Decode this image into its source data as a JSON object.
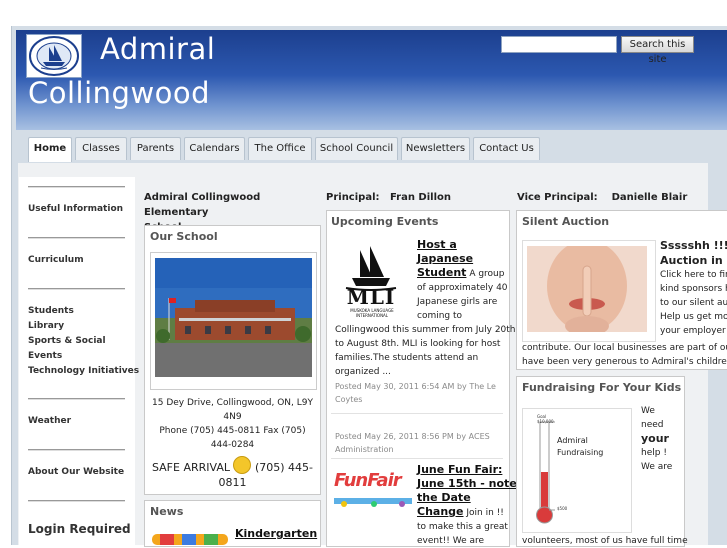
{
  "header": {
    "title_line1": "Admiral",
    "title_line2": "Collingwood",
    "logo_icon": "school-crest-icon"
  },
  "search": {
    "placeholder": "",
    "button_label": "Search this site"
  },
  "nav": {
    "tabs": [
      {
        "label": "Home",
        "active": true
      },
      {
        "label": "Classes"
      },
      {
        "label": "Parents"
      },
      {
        "label": "Calendars"
      },
      {
        "label": "The Office"
      },
      {
        "label": "School Council"
      },
      {
        "label": "Newsletters"
      },
      {
        "label": "Contact Us"
      }
    ]
  },
  "sidebar": {
    "useful_information": "Useful Information",
    "curriculum": "Curriculum",
    "students": "Students",
    "library": "Library",
    "sports_social_events": "Sports & Social",
    "events": "Events",
    "technology": "Technology Initiatives",
    "weather": "Weather",
    "about": "About Our Website",
    "login": "Login Required"
  },
  "left_col": {
    "heading_line1": "Admiral Collingwood Elementary",
    "heading_line2": "School",
    "our_school": {
      "title": "Our School",
      "address_line1": "15 Dey Drive, Collingwood, ON, L9Y",
      "address_line2": "4N9",
      "phone_line1": "Phone (705) 445-0811     Fax (705)",
      "phone_line2": "444-0284",
      "safe_arrival_a": "SAFE ARRIVAL",
      "safe_arrival_b": "(705) 445-",
      "safe_arrival_c": "0811"
    },
    "news": {
      "title": "News",
      "item1": "Kindergarten"
    }
  },
  "mid_col": {
    "principal_label": "Principal:",
    "principal_name": "Fran Dillon",
    "upcoming": {
      "title": "Upcoming Events",
      "event1": {
        "title_l1": "Host a",
        "title_l2": "Japanese",
        "title_l3": "Student",
        "desc_l1": "A group",
        "desc_l2": "of approximately 40",
        "desc_l3": "Japanese girls are",
        "desc_l4": "coming to",
        "desc_l5": "Collingwood this summer from July 20th",
        "desc_l6": "to August 8th. MLI is looking for host",
        "desc_l7": "families.The students attend an",
        "desc_l8": "organized ...",
        "meta_l1": "Posted May 30, 2011 6:54 AM by The Le",
        "meta_l2": "Coytes",
        "logo_text": "MLI",
        "logo_sub": "MUSKOKA LANGUAGE INTERNATIONAL"
      },
      "event2": {
        "meta_l1": "Posted May 26, 2011 8:56 PM by ACES",
        "meta_l2": "Administration"
      },
      "event3": {
        "title_l1": "June Fun Fair:",
        "title_l2": "June 15th - note",
        "title_l3": "the Date",
        "title_l4": "Change",
        "desc_l1": "Join in !!",
        "desc_l2": "to make this a great",
        "desc_l3": "event!! We are",
        "logo_text": "FunFair"
      }
    }
  },
  "right_col": {
    "vp_label": "Vice Principal:",
    "vp_name": "Danielle Blair",
    "auction": {
      "title": "Silent Auction",
      "headline_l1": "Ssssshh !!!;",
      "headline_l2": "Auction in p",
      "text_l1": "Click here to fin",
      "text_l2": "kind sponsors h",
      "text_l3": "to our silent auc",
      "text_l4": "Help us get mor",
      "text_l5": "your employer i",
      "text_l6": "contribute. Our local businesses are part of our c",
      "text_l7": "have been very generous to Admiral's children."
    },
    "fundraising": {
      "title": "Fundraising For Your Kids",
      "chart_label_l1": "Admiral",
      "chart_label_l2": "Fundraising",
      "goal_label": "Goal",
      "goal_value": "$10,000",
      "current_value": "$500",
      "text_l1": "We",
      "text_l2": "need",
      "text_l3": "your",
      "text_l4": "help !",
      "text_l5": "We are",
      "bottom": "volunteers, most of us have full time"
    }
  },
  "colors": {
    "header_top": "#1c3f8e",
    "header_bottom": "#a8c0e2",
    "frame": "#d4dde6"
  }
}
